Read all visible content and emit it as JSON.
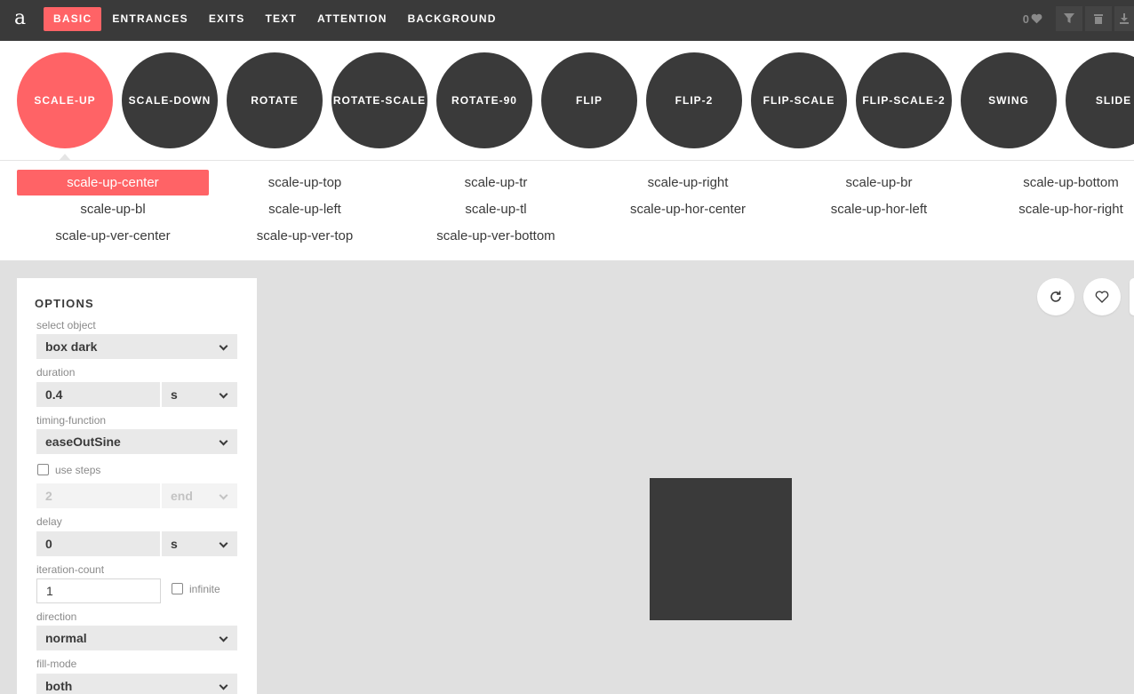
{
  "logo": "a",
  "nav": [
    "BASIC",
    "ENTRANCES",
    "EXITS",
    "TEXT",
    "ATTENTION",
    "BACKGROUND"
  ],
  "favorites_count": "0",
  "categories": [
    "SCALE-UP",
    "SCALE-DOWN",
    "ROTATE",
    "ROTATE-SCALE",
    "ROTATE-90",
    "FLIP",
    "FLIP-2",
    "FLIP-SCALE",
    "FLIP-SCALE-2",
    "SWING",
    "SLIDE"
  ],
  "variants": [
    "scale-up-center",
    "scale-up-top",
    "scale-up-tr",
    "scale-up-right",
    "scale-up-br",
    "scale-up-bottom",
    "scale-up-bl",
    "scale-up-left",
    "scale-up-tl",
    "scale-up-hor-center",
    "scale-up-hor-left",
    "scale-up-hor-right",
    "scale-up-ver-center",
    "scale-up-ver-top",
    "scale-up-ver-bottom"
  ],
  "options": {
    "title": "OPTIONS",
    "select_object_label": "select object",
    "select_object_value": "box dark",
    "duration_label": "duration",
    "duration_value": "0.4",
    "duration_unit": "s",
    "timing_label": "timing-function",
    "timing_value": "easeOutSine",
    "use_steps_label": "use steps",
    "steps_value": "2",
    "steps_position": "end",
    "delay_label": "delay",
    "delay_value": "0",
    "delay_unit": "s",
    "iteration_label": "iteration-count",
    "iteration_value": "1",
    "infinite_label": "infinite",
    "direction_label": "direction",
    "direction_value": "normal",
    "fill_mode_label": "fill-mode",
    "fill_mode_value": "both"
  },
  "colors": {
    "accent": "#ff6366",
    "dark": "#3a3a3a",
    "stage": "#e0e0e0"
  }
}
